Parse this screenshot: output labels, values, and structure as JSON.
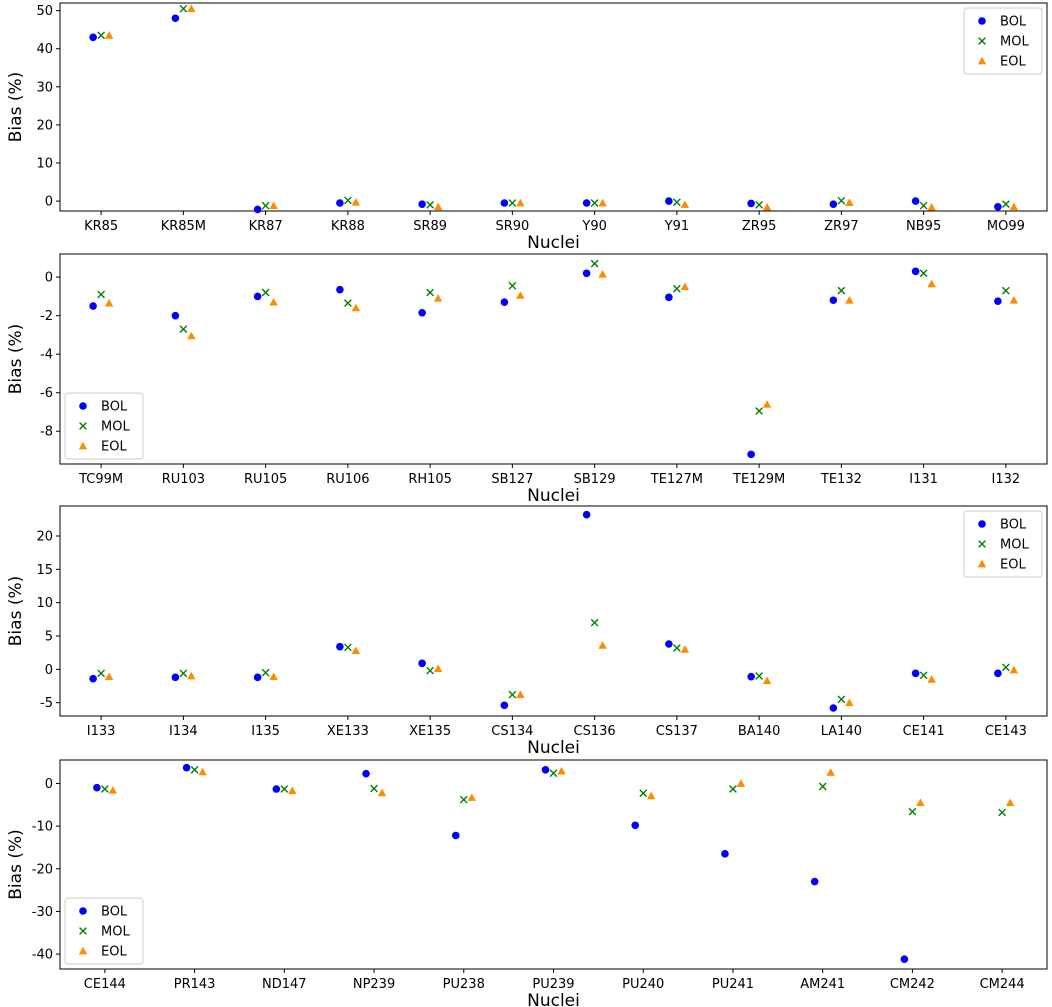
{
  "chart_data": [
    {
      "type": "scatter",
      "xlabel": "Nuclei",
      "ylabel": "Bias (%)",
      "categories": [
        "KR85",
        "KR85M",
        "KR87",
        "KR88",
        "SR89",
        "SR90",
        "Y90",
        "Y91",
        "ZR95",
        "ZR97",
        "NB95",
        "MO99"
      ],
      "ylim": [
        -2.6,
        52
      ],
      "yticks": [
        0,
        10,
        20,
        30,
        40,
        50
      ],
      "legend_position": "top-right",
      "series": [
        {
          "name": "BOL",
          "marker": "circle",
          "color": "#0000ff",
          "values": [
            43.0,
            48.0,
            -2.2,
            -0.5,
            -0.8,
            -0.5,
            -0.5,
            0.0,
            -0.6,
            -0.8,
            0.0,
            -1.5
          ]
        },
        {
          "name": "MOL",
          "marker": "x",
          "color": "#008000",
          "values": [
            43.5,
            50.5,
            -1.2,
            0.2,
            -1.0,
            -0.5,
            -0.5,
            -0.3,
            -1.0,
            0.1,
            -1.2,
            -0.8
          ]
        },
        {
          "name": "EOL",
          "marker": "triangle",
          "color": "#ff8c00",
          "values": [
            43.5,
            50.5,
            -1.2,
            -0.3,
            -1.5,
            -0.5,
            -0.5,
            -0.9,
            -1.6,
            -0.4,
            -1.6,
            -1.5
          ]
        }
      ]
    },
    {
      "type": "scatter",
      "xlabel": "Nuclei",
      "ylabel": "Bias (%)",
      "categories": [
        "TC99M",
        "RU103",
        "RU105",
        "RU106",
        "RH105",
        "SB127",
        "SB129",
        "TE127M",
        "TE129M",
        "TE132",
        "I131",
        "I132"
      ],
      "ylim": [
        -9.7,
        1.2
      ],
      "yticks": [
        -8,
        -6,
        -4,
        -2,
        0
      ],
      "legend_position": "bottom-left",
      "series": [
        {
          "name": "BOL",
          "marker": "circle",
          "color": "#0000ff",
          "values": [
            -1.5,
            -2.0,
            -1.0,
            -0.65,
            -1.85,
            -1.3,
            0.2,
            -1.05,
            -9.2,
            -1.2,
            0.3,
            -1.25
          ]
        },
        {
          "name": "MOL",
          "marker": "x",
          "color": "#008000",
          "values": [
            -0.9,
            -2.7,
            -0.8,
            -1.35,
            -0.8,
            -0.45,
            0.7,
            -0.6,
            -6.95,
            -0.7,
            0.2,
            -0.7
          ]
        },
        {
          "name": "EOL",
          "marker": "triangle",
          "color": "#ff8c00",
          "values": [
            -1.35,
            -3.05,
            -1.3,
            -1.6,
            -1.1,
            -0.95,
            0.15,
            -0.5,
            -6.6,
            -1.2,
            -0.35,
            -1.2
          ]
        }
      ]
    },
    {
      "type": "scatter",
      "xlabel": "Nuclei",
      "ylabel": "Bias (%)",
      "categories": [
        "I133",
        "I134",
        "I135",
        "XE133",
        "XE135",
        "CS134",
        "CS136",
        "CS137",
        "BA140",
        "LA140",
        "CE141",
        "CE143"
      ],
      "ylim": [
        -7,
        24.5
      ],
      "yticks": [
        -5,
        0,
        5,
        10,
        15,
        20
      ],
      "legend_position": "top-right",
      "series": [
        {
          "name": "BOL",
          "marker": "circle",
          "color": "#0000ff",
          "values": [
            -1.4,
            -1.2,
            -1.2,
            3.4,
            0.9,
            -5.4,
            23.2,
            3.8,
            -1.1,
            -5.8,
            -0.6,
            -0.6
          ]
        },
        {
          "name": "MOL",
          "marker": "x",
          "color": "#008000",
          "values": [
            -0.6,
            -0.6,
            -0.5,
            3.3,
            -0.2,
            -3.8,
            7.0,
            3.2,
            -1.0,
            -4.5,
            -0.9,
            0.3
          ]
        },
        {
          "name": "EOL",
          "marker": "triangle",
          "color": "#ff8c00",
          "values": [
            -1.1,
            -1.0,
            -1.1,
            2.8,
            0.1,
            -3.8,
            3.6,
            3.0,
            -1.7,
            -5.0,
            -1.5,
            -0.1
          ]
        }
      ]
    },
    {
      "type": "scatter",
      "xlabel": "Nuclei",
      "ylabel": "Bias (%)",
      "categories": [
        "CE144",
        "PR143",
        "ND147",
        "NP239",
        "PU238",
        "PU239",
        "PU240",
        "PU241",
        "AM241",
        "CM242",
        "CM244"
      ],
      "ylim": [
        -43.5,
        5.5
      ],
      "yticks": [
        -40,
        -30,
        -20,
        -10,
        0
      ],
      "legend_position": "bottom-left",
      "series": [
        {
          "name": "BOL",
          "marker": "circle",
          "color": "#0000ff",
          "values": [
            -1.0,
            3.7,
            -1.3,
            2.3,
            -12.2,
            3.2,
            -9.8,
            -16.5,
            -23.0,
            -41.2,
            null
          ]
        },
        {
          "name": "MOL",
          "marker": "x",
          "color": "#008000",
          "values": [
            -1.3,
            3.2,
            -1.3,
            -1.2,
            -3.8,
            2.4,
            -2.3,
            -1.3,
            -0.7,
            -6.6,
            -6.8
          ]
        },
        {
          "name": "EOL",
          "marker": "triangle",
          "color": "#ff8c00",
          "values": [
            -1.6,
            2.7,
            -1.7,
            -2.2,
            -3.3,
            2.9,
            -2.9,
            0.0,
            2.6,
            -4.5,
            -4.5
          ]
        }
      ]
    }
  ]
}
